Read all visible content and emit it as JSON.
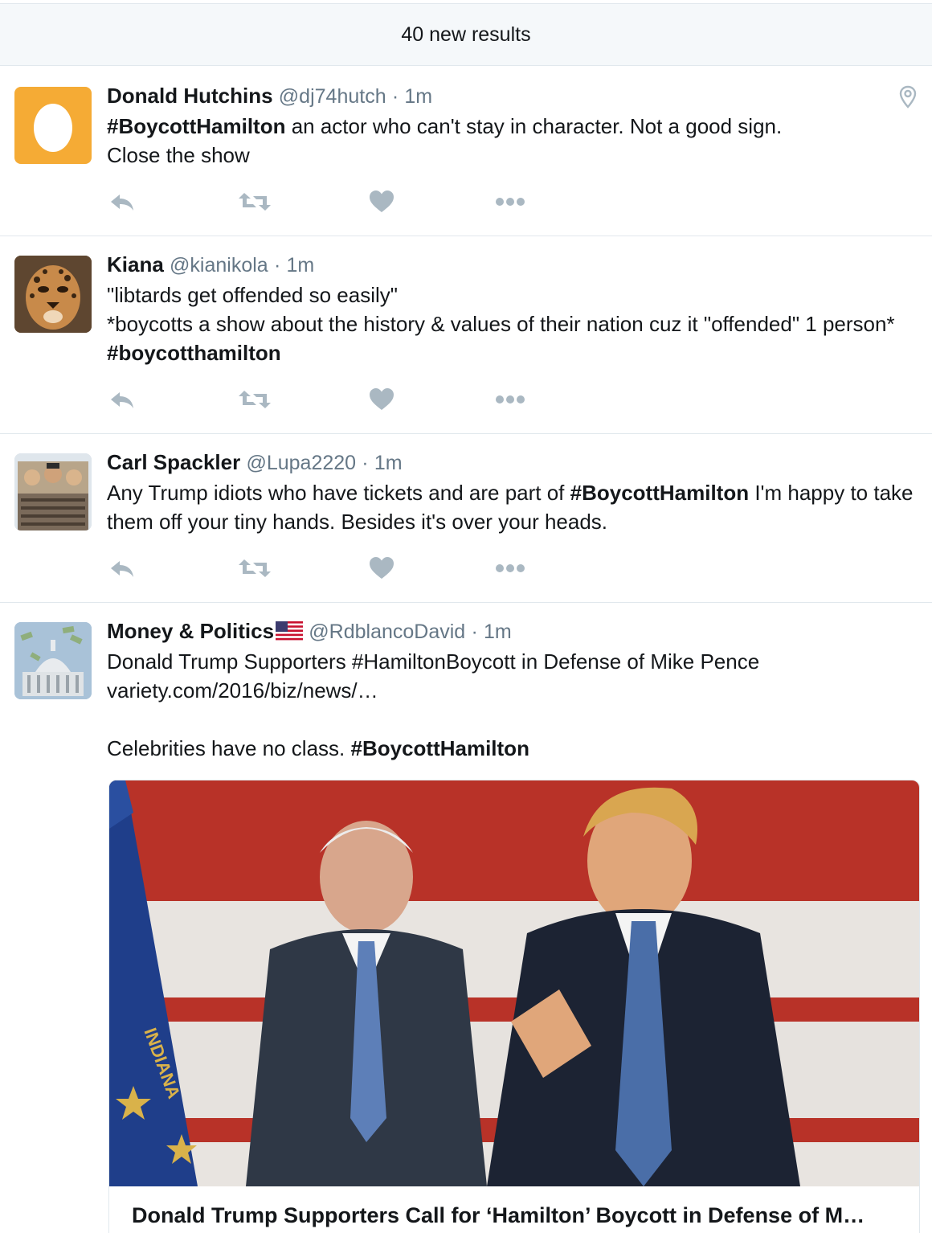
{
  "banner": {
    "label": "40 new results"
  },
  "tweets": [
    {
      "name": "Donald Hutchins",
      "handle": "@dj74hutch",
      "separator": "·",
      "time": "1m",
      "text_parts": [
        "#BoycottHamilton",
        " an actor who can't stay in character.  Not a good sign.",
        "Close the show"
      ]
    },
    {
      "name": "Kiana",
      "handle": "@kianikola",
      "separator": "·",
      "time": "1m",
      "text_parts": [
        "\"libtards get offended so easily\"",
        "*boycotts a show about the history & values of their nation cuz it \"offended\" 1 person*  ",
        "#boycotthamilton"
      ]
    },
    {
      "name": "Carl Spackler",
      "handle": "@Lupa2220",
      "separator": "·",
      "time": "1m",
      "text_parts": [
        "Any Trump idiots who have tickets and are part of ",
        "#BoycottHamilton",
        " I'm happy to take them off your tiny hands. Besides it's over your heads."
      ]
    },
    {
      "name": "Money & Politics",
      "handle": "@RdblancoDavid",
      "separator": "·",
      "time": "1m",
      "text_parts": [
        "Donald Trump Supporters #HamiltonBoycott in Defense of Mike Pence",
        "variety.com/2016/biz/news/…",
        "Celebrities have no class. ",
        "#BoycottHamilton"
      ],
      "card_title": "Donald Trump Supporters Call for ‘Hamilton’ Boycott in Defense of M…"
    }
  ],
  "icons": [
    "location-pin-icon",
    "reply-icon",
    "retweet-icon",
    "like-icon",
    "more-icon",
    "us-flag-icon"
  ],
  "colors": {
    "action_gray": "#aab8c2",
    "meta_gray": "#657786",
    "egg_bg": "#f5ab35"
  }
}
